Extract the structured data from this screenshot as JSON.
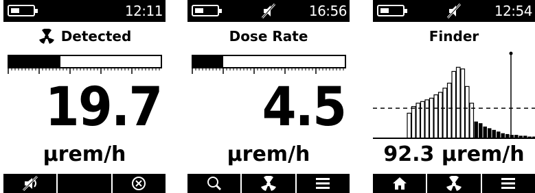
{
  "screens": [
    {
      "status": {
        "time": "12:11",
        "battery_level": "low",
        "muted": false
      },
      "title": "Detected",
      "title_icon": "radiation-icon",
      "bar_level": 0.34,
      "value": "19.7",
      "unit": "µrem/h",
      "softkeys": [
        "mute-off-icon",
        "",
        "close-circle-icon"
      ]
    },
    {
      "status": {
        "time": "16:56",
        "battery_level": "low",
        "muted": true
      },
      "title": "Dose Rate",
      "bar_level": 0.2,
      "value": "4.5",
      "unit": "µrem/h",
      "softkeys": [
        "search-icon",
        "radiation-icon",
        "menu-icon"
      ]
    },
    {
      "status": {
        "time": "12:54",
        "battery_level": "low",
        "muted": true
      },
      "title": "Finder",
      "reading": "92.3 µrem/h",
      "histogram": {
        "values": [
          30,
          38,
          42,
          44,
          46,
          48,
          52,
          55,
          60,
          66,
          80,
          85,
          83,
          62,
          42,
          20,
          18,
          14,
          12,
          10,
          8,
          6,
          5,
          4,
          4,
          3,
          3,
          2,
          2,
          2
        ],
        "threshold": 36,
        "max": 100
      },
      "softkeys": [
        "home-icon",
        "radiation-icon",
        "menu-icon"
      ]
    }
  ],
  "colors": {
    "foreground": "#000000",
    "background": "#ffffff"
  }
}
